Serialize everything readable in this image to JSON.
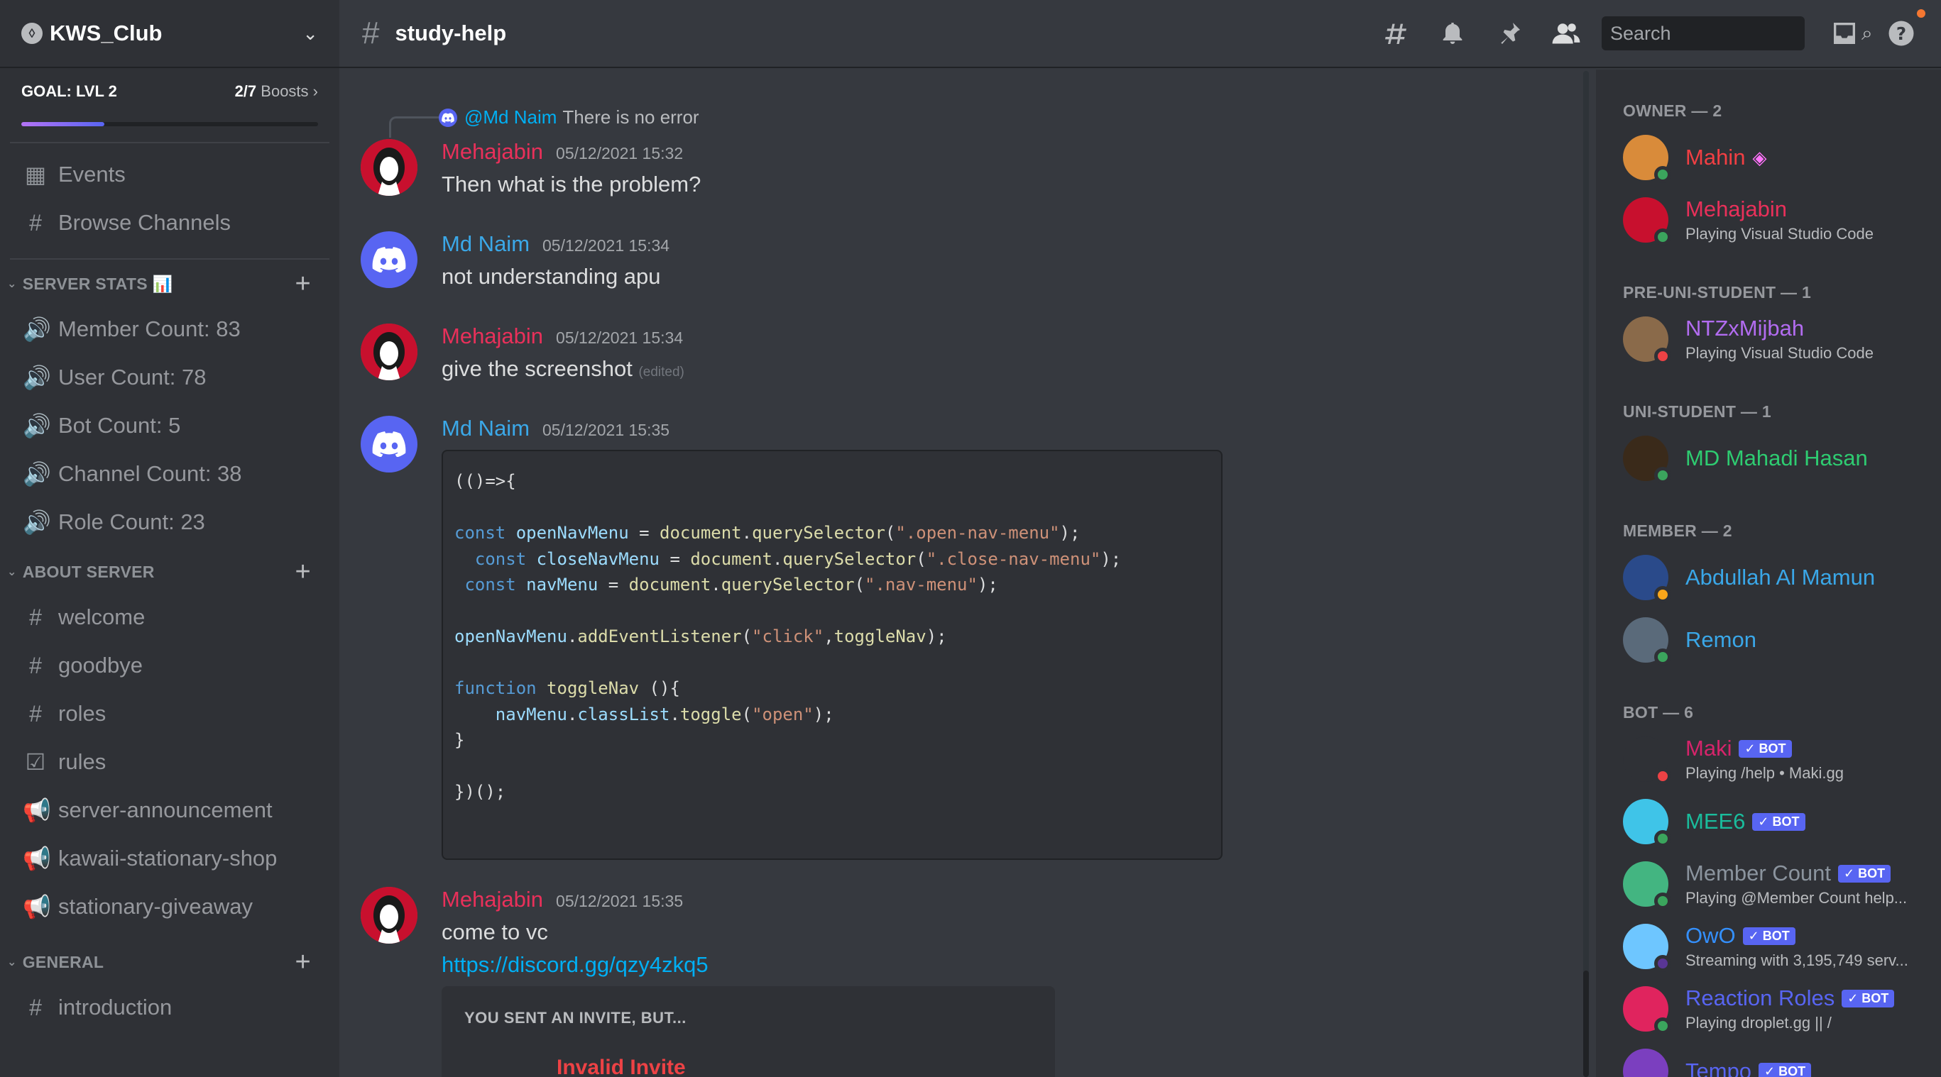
{
  "server": {
    "name": "KWS_Club",
    "icon": "server-shield-icon"
  },
  "boost": {
    "goal": "GOAL: LVL 2",
    "progress_count": "2/7",
    "progress_label": "Boosts",
    "progress_fraction": 0.28
  },
  "nav": {
    "events": "Events",
    "browse": "Browse Channels"
  },
  "categories": {
    "stats": "SERVER STATS 📊",
    "about": "ABOUT SERVER",
    "general": "GENERAL"
  },
  "stats_channels": [
    "Member Count: 83",
    "User Count: 78",
    "Bot Count: 5",
    "Channel Count: 38",
    "Role Count: 23"
  ],
  "about_channels": [
    "welcome",
    "goodbye",
    "roles",
    "rules",
    "server-announcement",
    "kawaii-stationary-shop",
    "stationary-giveaway"
  ],
  "general_channels": [
    "introduction"
  ],
  "topbar": {
    "channel": "study-help",
    "search_placeholder": "Search"
  },
  "messages": {
    "reply": {
      "mention": "@Md Naim",
      "text": "There is no error"
    },
    "m1": {
      "user": "Mehajabin",
      "time": "05/12/2021 15:32",
      "text": "Then what is the problem?"
    },
    "m2": {
      "user": "Md Naim",
      "time": "05/12/2021 15:34",
      "text": "not understanding apu"
    },
    "m3": {
      "user": "Mehajabin",
      "time": "05/12/2021 15:34",
      "text": "give the screenshot",
      "edited": "(edited)"
    },
    "m4": {
      "user": "Md Naim",
      "time": "05/12/2021 15:35"
    },
    "m5": {
      "user": "Mehajabin",
      "time": "05/12/2021 15:35",
      "text": "come to vc",
      "link": "https://discord.gg/qzy4zkq5"
    },
    "invite": {
      "title": "YOU SENT AN INVITE, BUT...",
      "status": "Invalid Invite"
    }
  },
  "code_lines": [
    "(()=>{",
    "",
    "const openNavMenu = document.querySelector(\".open-nav-menu\");",
    "  const closeNavMenu = document.querySelector(\".close-nav-menu\");",
    " const navMenu = document.querySelector(\".nav-menu\");",
    "",
    "openNavMenu.addEventListener(\"click\",toggleNav);",
    "",
    "function toggleNav (){",
    "    navMenu.classList.toggle(\"open\");",
    "}",
    "",
    "})();"
  ],
  "members": {
    "owner_cat": "OWNER — 2",
    "pre_cat": "PRE-UNI-STUDENT — 1",
    "uni_cat": "UNI-STUDENT — 1",
    "member_cat": "MEMBER — 2",
    "bot_cat": "BOT — 6",
    "list": [
      {
        "name": "Mahin",
        "sub": ""
      },
      {
        "name": "Mehajabin",
        "sub": "Playing Visual Studio Code"
      },
      {
        "name": "NTZxMijbah",
        "sub": "Playing Visual Studio Code"
      },
      {
        "name": "MD Mahadi Hasan",
        "sub": ""
      },
      {
        "name": "Abdullah Al Mamun",
        "sub": ""
      },
      {
        "name": "Remon",
        "sub": ""
      },
      {
        "name": "Maki",
        "sub": "Playing /help • Maki.gg"
      },
      {
        "name": "MEE6",
        "sub": ""
      },
      {
        "name": "Member Count",
        "sub": "Playing @Member Count help..."
      },
      {
        "name": "OwO",
        "sub": "Streaming with 3,195,749 serv..."
      },
      {
        "name": "Reaction Roles",
        "sub": "Playing droplet.gg || /"
      },
      {
        "name": "Tempo",
        "sub": ""
      }
    ],
    "bot_label": "✓ BOT"
  },
  "colors": {
    "mehajabin": "#e9305a",
    "naim": "#3ba8e8",
    "mahin": "#f23f43",
    "ntz": "#b26cf0",
    "mahadi": "#2ecc71",
    "member_blue": "#3aa7e8",
    "maki": "#d6246b",
    "mee6": "#1abc9c",
    "membercount": "#8b949e",
    "owo": "#3490ff",
    "reaction": "#5865f2",
    "tempo": "#5865f2"
  }
}
